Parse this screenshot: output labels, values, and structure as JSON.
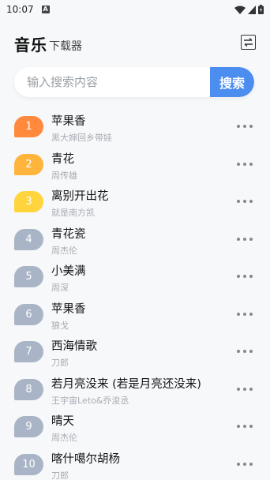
{
  "status_bar": {
    "time": "10:07",
    "notification_icon": "A"
  },
  "header": {
    "title": "音乐",
    "subtitle": "下载器",
    "menu_icon": "swap-icon"
  },
  "search": {
    "placeholder": "输入搜索内容",
    "value": "",
    "button_label": "搜索",
    "button_color": "#4c8df0"
  },
  "songs": [
    {
      "rank": "1",
      "title": "苹果香",
      "artist": "黑大婶回乡带娃",
      "badge_color": "#ff8a3d"
    },
    {
      "rank": "2",
      "title": "青花",
      "artist": "周传雄",
      "badge_color": "#ffb53c"
    },
    {
      "rank": "3",
      "title": "离别开出花",
      "artist": "就是南方凯",
      "badge_color": "#ffd43c"
    },
    {
      "rank": "4",
      "title": "青花瓷",
      "artist": "周杰伦",
      "badge_color": "#a9b4c6"
    },
    {
      "rank": "5",
      "title": "小美满",
      "artist": "周深",
      "badge_color": "#a9b4c6"
    },
    {
      "rank": "6",
      "title": "苹果香",
      "artist": "狼戈",
      "badge_color": "#a9b4c6"
    },
    {
      "rank": "7",
      "title": "西海情歌",
      "artist": "刀郎",
      "badge_color": "#a9b4c6"
    },
    {
      "rank": "8",
      "title": "若月亮没来 (若是月亮还没来)",
      "artist": "王宇宙Leto&乔浚丞",
      "badge_color": "#a9b4c6"
    },
    {
      "rank": "9",
      "title": "晴天",
      "artist": "周杰伦",
      "badge_color": "#a9b4c6"
    },
    {
      "rank": "10",
      "title": "喀什噶尔胡杨",
      "artist": "刀郎",
      "badge_color": "#a9b4c6"
    }
  ]
}
